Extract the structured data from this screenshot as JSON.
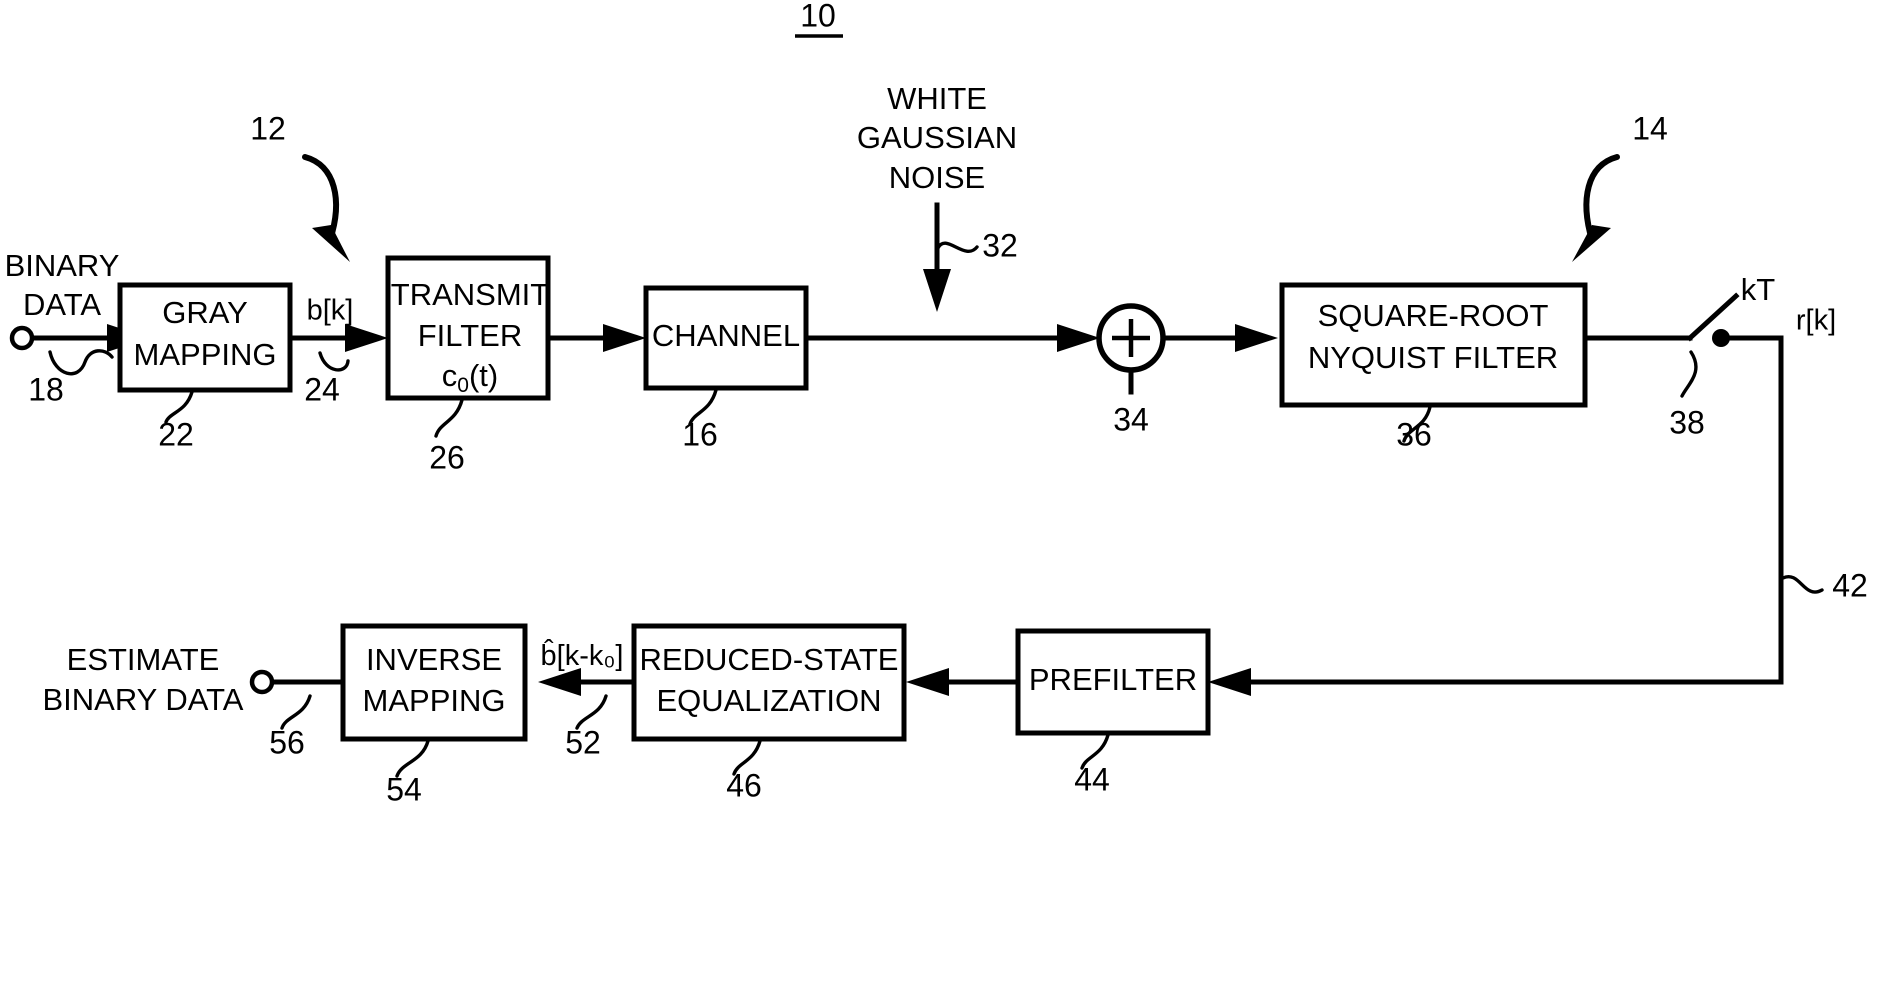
{
  "figure": {
    "number": "10",
    "transmitter_ref": "12",
    "receiver_ref": "14"
  },
  "blocks": [
    {
      "id": "gray_mapping",
      "label_line1": "GRAY",
      "label_line2": "MAPPING",
      "label_line3": "",
      "ref": "22"
    },
    {
      "id": "transmit_filter",
      "label_line1": "TRANSMIT",
      "label_line2": "FILTER",
      "label_line3": "c",
      "ref": "26"
    },
    {
      "id": "channel",
      "label_line1": "CHANNEL",
      "label_line2": "",
      "label_line3": "",
      "ref": "16"
    },
    {
      "id": "sqrt_nyquist",
      "label_line1": "SQUARE-ROOT",
      "label_line2": "NYQUIST FILTER",
      "label_line3": "",
      "ref": "36"
    },
    {
      "id": "prefilter",
      "label_line1": "PREFILTER",
      "label_line2": "",
      "label_line3": "",
      "ref": "44"
    },
    {
      "id": "rse",
      "label_line1": "REDUCED-STATE",
      "label_line2": "EQUALIZATION",
      "label_line3": "",
      "ref": "46"
    },
    {
      "id": "inverse_mapping",
      "label_line1": "INVERSE",
      "label_line2": "MAPPING",
      "label_line3": "",
      "ref": "54"
    }
  ],
  "transmit_filter_impulse": {
    "base": "c",
    "subscript": "0",
    "arg": "(t)"
  },
  "noise": {
    "line1": "WHITE",
    "line2": "GAUSSIAN",
    "line3": "NOISE",
    "ref": "32"
  },
  "adder": {
    "symbol": "+",
    "ref": "34"
  },
  "sampler": {
    "rate_label": "kT",
    "ref": "38"
  },
  "io": {
    "input_line1": "BINARY",
    "input_line2": "DATA",
    "input_ref": "18",
    "output_line1": "ESTIMATE",
    "output_line2": "BINARY DATA",
    "output_ref": "56"
  },
  "signals": [
    {
      "id": "b_k",
      "text": "b[k]",
      "ref": "24"
    },
    {
      "id": "r_k",
      "text": "r[k]",
      "ref": "42"
    },
    {
      "id": "bhat_kk0",
      "base": "b",
      "hat": "^",
      "rest": "[k-k",
      "sub": "0",
      "close": "]",
      "text": "b̂[k-k₀]",
      "ref": "52"
    }
  ],
  "refnums": {
    "fig": "10",
    "tx": "12",
    "rx": "14",
    "input": "18",
    "gray": "22",
    "bk": "24",
    "txfilter": "26",
    "channel": "16",
    "noise": "32",
    "adder": "34",
    "nyquist": "36",
    "sampler": "38",
    "rk": "42",
    "prefilter": "44",
    "rse": "46",
    "bhat": "52",
    "invmap": "54",
    "output": "56"
  }
}
